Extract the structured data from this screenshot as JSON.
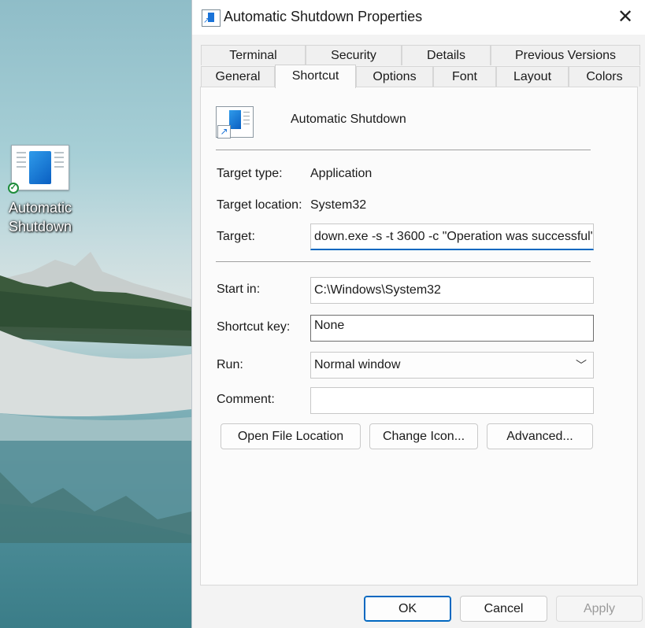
{
  "desktop": {
    "icon_label": "Automatic Shutdown"
  },
  "dialog": {
    "title": "Automatic Shutdown Properties",
    "close_glyph": "✕",
    "tabs_row1": [
      "Terminal",
      "Security",
      "Details",
      "Previous Versions"
    ],
    "tabs_row2": [
      "General",
      "Shortcut",
      "Options",
      "Font",
      "Layout",
      "Colors"
    ],
    "active_tab": "Shortcut",
    "shortcut_name": "Automatic Shutdown",
    "target_type_label": "Target type:",
    "target_type_value": "Application",
    "target_location_label": "Target location:",
    "target_location_value": "System32",
    "target_label": "Target:",
    "target_value": "down.exe -s -t 3600 -c \"Operation was successful\"",
    "start_in_label": "Start in:",
    "start_in_value": "C:\\Windows\\System32",
    "shortcut_key_label": "Shortcut key:",
    "shortcut_key_value": "None",
    "run_label": "Run:",
    "run_value": "Normal window",
    "comment_label": "Comment:",
    "comment_value": "",
    "buttons": {
      "open_file_location": "Open File Location",
      "change_icon": "Change Icon...",
      "advanced": "Advanced..."
    },
    "footer": {
      "ok": "OK",
      "cancel": "Cancel",
      "apply": "Apply"
    }
  },
  "colors": {
    "accent": "#0067c0",
    "icon_blue": "#1a73d8"
  },
  "icons": [
    "shortcut-arrow-icon",
    "checkmark-icon",
    "close-icon",
    "chevron-down-icon"
  ]
}
